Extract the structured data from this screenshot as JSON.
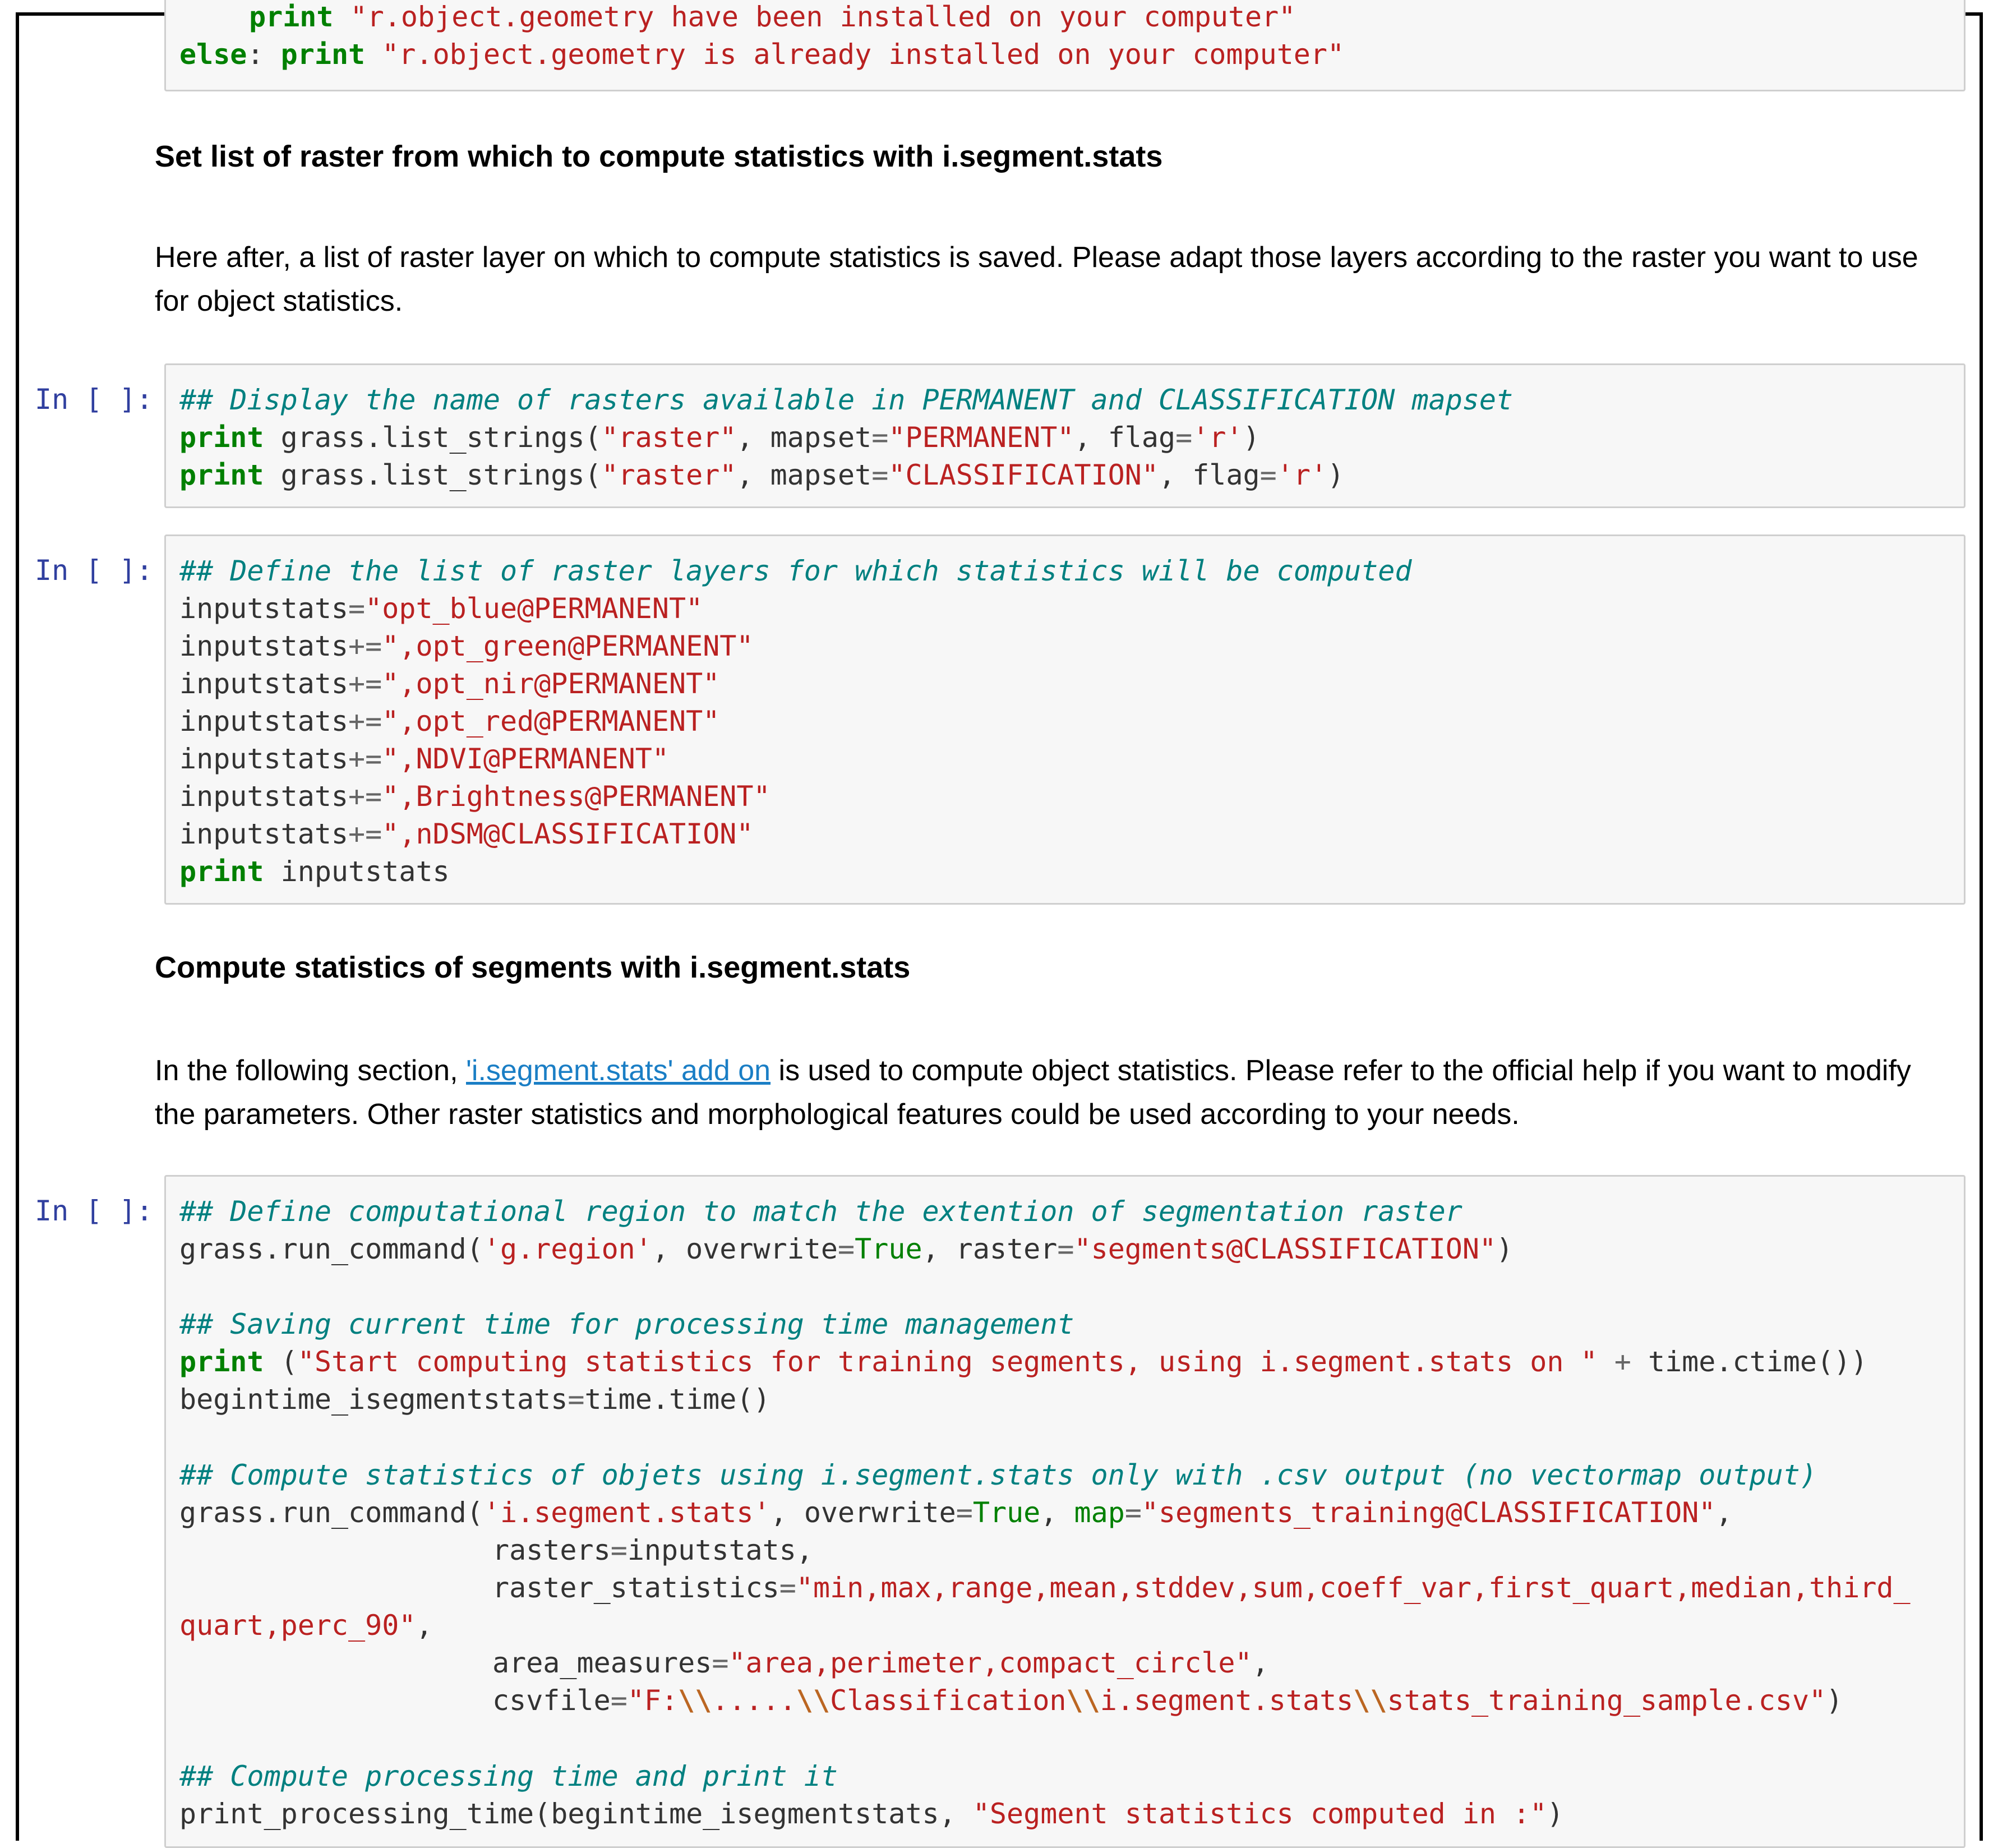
{
  "cell0": {
    "line0": {
      "p1": "print",
      "p2": " ",
      "p3": "\"r.object.geometry have been installed on your computer\""
    },
    "line1": {
      "p1": "else",
      "p2": ": ",
      "p3": "print",
      "p4": " ",
      "p5": "\"r.object.geometry is already installed on your computer\""
    }
  },
  "heading1": "Set list of raster from which to compute statistics with i.segment.stats",
  "para1": "Here after, a list of raster layer on which to compute statistics is saved. Please adapt those layers according to the raster you want to use for object statistics.",
  "prompt_label": "In [ ]:",
  "cell1": {
    "l0": "## Display the name of rasters available in PERMANENT and CLASSIFICATION mapset",
    "l1": {
      "kw": "print",
      "a": " grass.list_strings(",
      "s1": "\"raster\"",
      "b": ", mapset",
      "eq": "=",
      "s2": "\"PERMANENT\"",
      "c": ", flag",
      "eq2": "=",
      "s3": "'r'",
      "d": ")"
    },
    "l2": {
      "kw": "print",
      "a": " grass.list_strings(",
      "s1": "\"raster\"",
      "b": ", mapset",
      "eq": "=",
      "s2": "\"CLASSIFICATION\"",
      "c": ", flag",
      "eq2": "=",
      "s3": "'r'",
      "d": ")"
    }
  },
  "cell2": {
    "l0": "## Define the list of raster layers for which statistics will be computed",
    "l1": {
      "a": "inputstats",
      "op": "=",
      "s": "\"opt_blue@PERMANENT\""
    },
    "l2": {
      "a": "inputstats",
      "op": "+=",
      "s": "\",opt_green@PERMANENT\""
    },
    "l3": {
      "a": "inputstats",
      "op": "+=",
      "s": "\",opt_nir@PERMANENT\""
    },
    "l4": {
      "a": "inputstats",
      "op": "+=",
      "s": "\",opt_red@PERMANENT\""
    },
    "l5": {
      "a": "inputstats",
      "op": "+=",
      "s": "\",NDVI@PERMANENT\""
    },
    "l6": {
      "a": "inputstats",
      "op": "+=",
      "s": "\",Brightness@PERMANENT\""
    },
    "l7": {
      "a": "inputstats",
      "op": "+=",
      "s": "\",nDSM@CLASSIFICATION\""
    },
    "l8": {
      "kw": "print",
      "a": " inputstats"
    }
  },
  "heading2": "Compute statistics of segments with i.segment.stats",
  "para2": {
    "before": "In the following section, ",
    "link": "'i.segment.stats' add on",
    "after": " is used to compute object statistics. Please refer to the official help if you want to modify the parameters. Other raster statistics and morphological features could be used according to your needs."
  },
  "cell3": {
    "c1": "## Define computational region to match the extention of segmentation raster",
    "r1": {
      "a": "grass.run_command(",
      "s1": "'g.region'",
      "b": ", overwrite",
      "eq": "=",
      "t": "True",
      "c": ", raster",
      "eq2": "=",
      "s2": "\"segments@CLASSIFICATION\"",
      "d": ")"
    },
    "c2": "## Saving current time for processing time management",
    "p1": {
      "kw": "print",
      "a": " (",
      "s": "\"Start computing statistics for training segments, using i.segment.stats on \"",
      "b": " ",
      "op": "+",
      "c": " time.ctime())"
    },
    "p2": {
      "a": "begintime_isegmentstats",
      "op": "=",
      "b": "time.time()"
    },
    "c3": "## Compute statistics of objets using i.segment.stats only with .csv output (no vectormap output)",
    "g1": {
      "a": "grass.run_command(",
      "s1": "'i.segment.stats'",
      "b": ", overwrite",
      "eq": "=",
      "t": "True",
      "c": ", ",
      "m": "map",
      "eq2": "=",
      "s2": "\"segments_training@CLASSIFICATION\"",
      "d": ","
    },
    "g2": {
      "a": "rasters",
      "eq": "=",
      "b": "inputstats,"
    },
    "g3": {
      "a": "raster_statistics",
      "eq": "=",
      "s": "\"min,max,range,mean,stddev,sum,coeff_var,first_quart,median,third_"
    },
    "g4": {
      "s": "quart,perc_90\"",
      "b": ","
    },
    "g5": {
      "a": "area_measures",
      "eq": "=",
      "s": "\"area,perimeter,compact_circle\"",
      "b": ","
    },
    "g6": {
      "a": "csvfile",
      "eq": "=",
      "s1": "\"F:",
      "e1": "\\\\",
      "s2": ".....",
      "e2": "\\\\",
      "s3": "Classification",
      "e3": "\\\\",
      "s4": "i.segment.stats",
      "e4": "\\\\",
      "s5": "stats_training_sample.csv\"",
      "b": ")"
    },
    "c4": "## Compute processing time and print it",
    "last": {
      "a": "print_processing_time(begintime_isegmentstats, ",
      "s": "\"Segment statistics computed in :\"",
      "b": ")"
    }
  }
}
